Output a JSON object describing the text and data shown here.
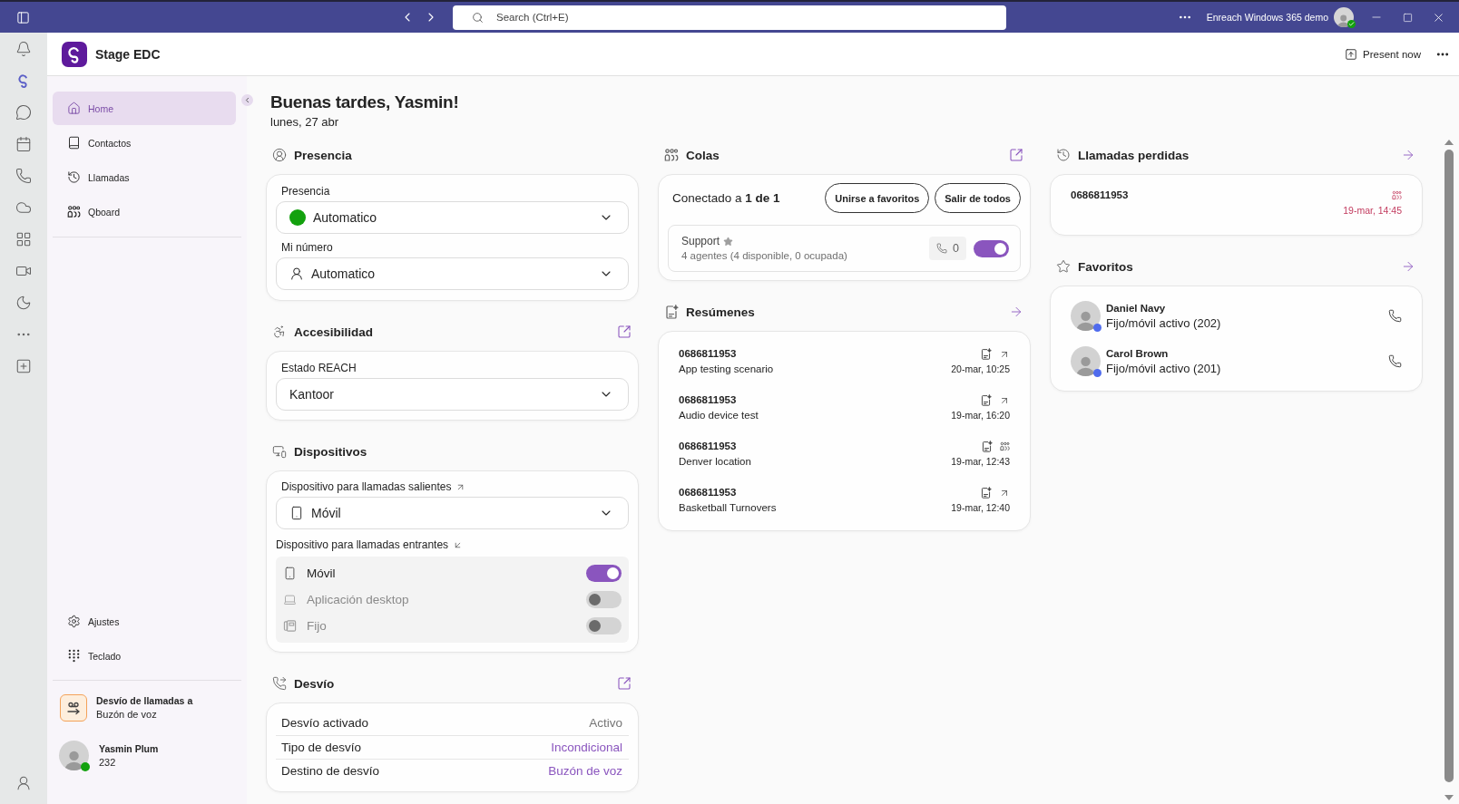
{
  "titlebar": {
    "search": {
      "placeholder": "Search (Ctrl+E)"
    },
    "account": "Enreach Windows 365 demo",
    "online": true
  },
  "rail": {
    "items": [
      {
        "selected": false
      },
      {
        "selected": true
      },
      {
        "selected": false
      },
      {
        "selected": false
      },
      {
        "selected": false
      },
      {
        "selected": false
      },
      {
        "selected": false
      },
      {
        "selected": false
      },
      {
        "selected": false
      },
      {
        "selected": false
      },
      {
        "selected": false
      }
    ]
  },
  "app": {
    "title": "Stage EDC",
    "present_button": "Present now"
  },
  "sidebar": {
    "nav": [
      {
        "label": "Home",
        "kind": "home",
        "selected": true
      },
      {
        "label": "Contactos",
        "kind": "contacts",
        "selected": false
      },
      {
        "label": "Llamadas",
        "kind": "calls",
        "selected": false
      },
      {
        "label": "Qboard",
        "kind": "qboard",
        "selected": false
      }
    ],
    "bottom_nav": [
      {
        "label": "Ajustes",
        "kind": "settings",
        "selected": false
      },
      {
        "label": "Teclado",
        "kind": "keypad",
        "selected": false
      }
    ],
    "forwarding": {
      "title": "Desvío de llamadas a",
      "value": "Buzón de voz"
    },
    "user": {
      "name": "Yasmin Plum",
      "extension": "232",
      "online": true
    }
  },
  "greeting": {
    "title": "Buenas tardes, Yasmin!",
    "date": "lunes, 27 abr"
  },
  "presence": {
    "title": "Presencia",
    "fields": [
      {
        "label": "Presencia",
        "value": "Automatico",
        "kind": "status"
      },
      {
        "label": "Mi número",
        "value": "Automatico",
        "kind": "person"
      }
    ]
  },
  "accessibility": {
    "title": "Accesibilidad",
    "header_action": {
      "kind": "external"
    },
    "fields": [
      {
        "label": "Estado REACH",
        "value": "Kantoor"
      }
    ]
  },
  "devices": {
    "title": "Dispositivos",
    "outgoing": {
      "label": "Dispositivo para llamadas salientes",
      "value": "Móvil",
      "kind": "mobile"
    },
    "incoming": {
      "label": "Dispositivo para llamadas entrantes",
      "devices": [
        {
          "name": "Móvil",
          "kind": "mobile",
          "on": true
        },
        {
          "name": "Aplicación desktop",
          "kind": "desktop",
          "on": false
        },
        {
          "name": "Fijo",
          "kind": "desk_phone",
          "on": false
        }
      ]
    }
  },
  "forwarding": {
    "title": "Desvío",
    "header_action": {
      "kind": "external"
    },
    "rows": [
      {
        "label": "Desvío activado",
        "value": "Activo",
        "kind": "plain"
      },
      {
        "label": "Tipo de desvío",
        "value": "Incondicional",
        "kind": "link"
      },
      {
        "label": "Destino de desvío",
        "value": "Buzón de voz",
        "kind": "link"
      }
    ]
  },
  "queues": {
    "title": "Colas",
    "header_action": {
      "kind": "external"
    },
    "connected": "Conectado a **1 de 1**",
    "buttons": [
      "Unirse a favoritos",
      "Salir de todos"
    ],
    "items": [
      {
        "name": "Support",
        "favorite": true,
        "agents": "4 agentes (4 disponible, 0 ocupada)",
        "calls": "0",
        "on": true
      }
    ]
  },
  "summaries": {
    "title": "Resúmenes",
    "header_action": {
      "kind": "arrow"
    },
    "items": [
      {
        "number": "0686811953",
        "title": "App testing scenario",
        "time": "20-mar, 10:25",
        "kind": "outgoing"
      },
      {
        "number": "0686811953",
        "title": "Audio device test",
        "time": "19-mar, 16:20",
        "kind": "outgoing"
      },
      {
        "number": "0686811953",
        "title": "Denver location",
        "time": "19-mar, 12:43",
        "kind": "queue"
      },
      {
        "number": "0686811953",
        "title": "Basketball Turnovers",
        "time": "19-mar, 12:40",
        "kind": "outgoing"
      }
    ]
  },
  "missed_calls": {
    "title": "Llamadas perdidas",
    "header_action": {
      "kind": "arrow"
    },
    "items": [
      {
        "number": "0686811953",
        "time": "19-mar, 14:45",
        "kind": "queue"
      }
    ]
  },
  "favorites": {
    "title": "Favoritos",
    "header_action": {
      "kind": "arrow"
    },
    "contacts": [
      {
        "name": "Daniel Navy",
        "status": "Fijo/móvil activo (202)",
        "online": true
      },
      {
        "name": "Carol Brown",
        "status": "Fijo/móvil activo (201)",
        "online": true
      }
    ]
  }
}
